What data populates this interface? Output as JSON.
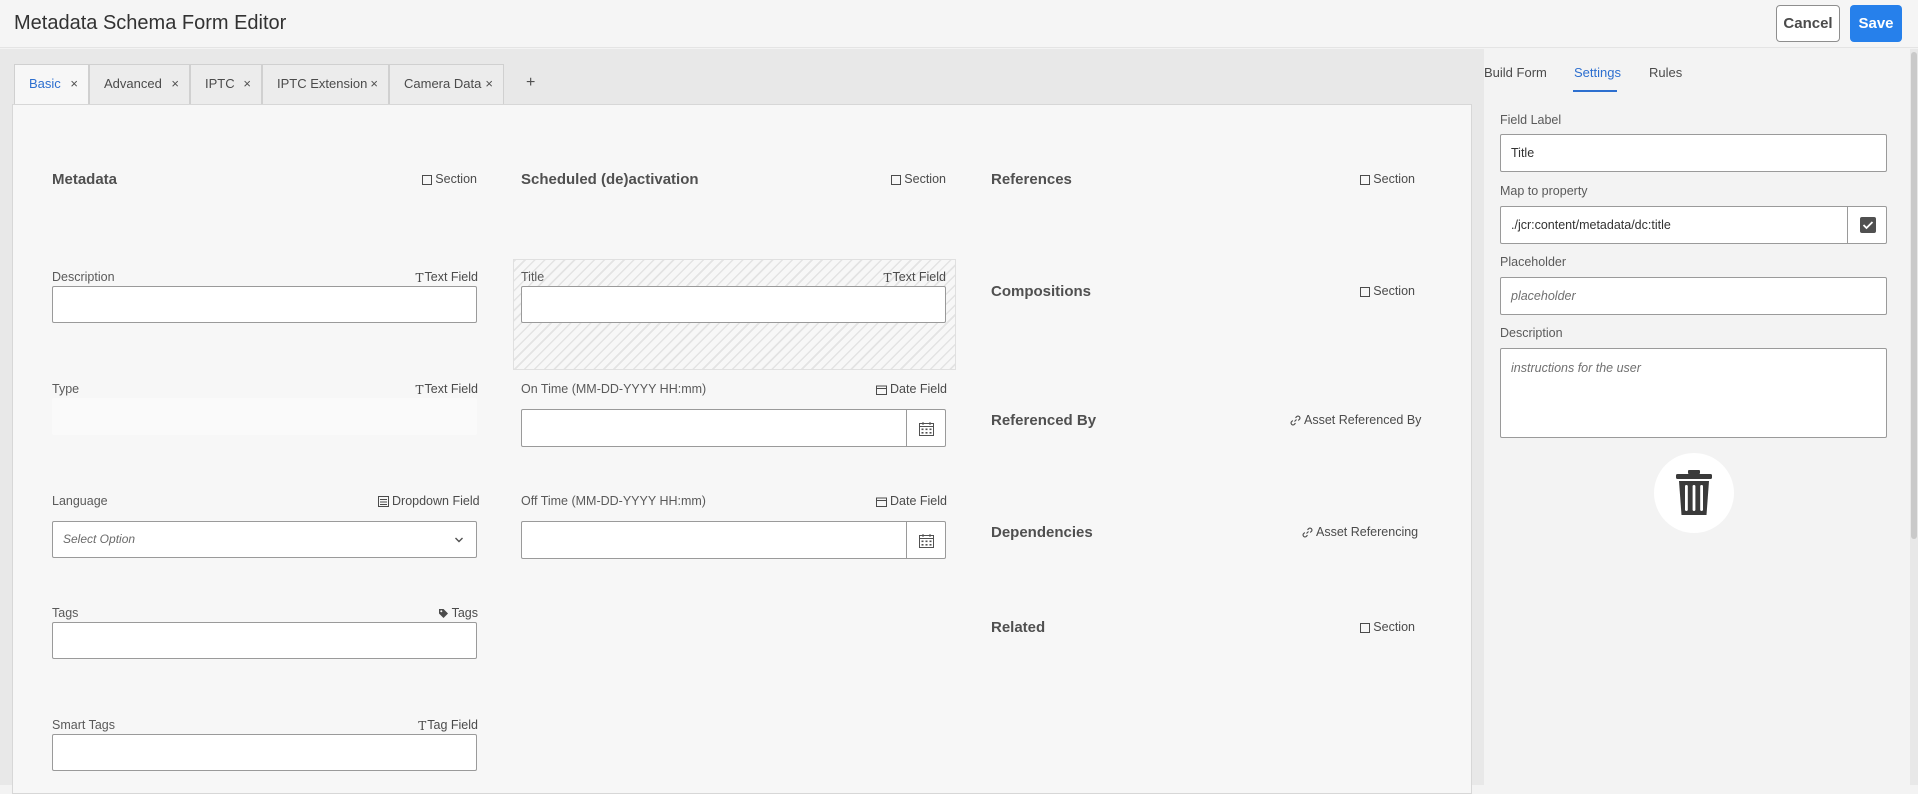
{
  "app": {
    "title": "Metadata Schema Form Editor"
  },
  "header": {
    "cancel_label": "Cancel",
    "save_label": "Save"
  },
  "tabs": [
    {
      "label": "Basic",
      "active": true
    },
    {
      "label": "Advanced"
    },
    {
      "label": "IPTC"
    },
    {
      "label": "IPTC Extension"
    },
    {
      "label": "Camera Data"
    }
  ],
  "tab_close_glyph": "×",
  "tab_add_glyph": "+",
  "columns": {
    "col1": {
      "title": "Metadata",
      "type": "Section",
      "fields": [
        {
          "label": "Description",
          "type": "Text Field"
        },
        {
          "label": "Type",
          "type": "Text Field"
        },
        {
          "label": "Language",
          "type": "Dropdown Field",
          "value": "Select Option"
        },
        {
          "label": "Tags",
          "type": "Tags"
        },
        {
          "label": "Smart Tags",
          "type": "Tag Field"
        }
      ]
    },
    "col2": {
      "title": "Scheduled (de)activation",
      "type": "Section",
      "fields": [
        {
          "label": "Title",
          "type": "Text Field"
        },
        {
          "label": "On Time (MM-DD-YYYY HH:mm)",
          "type": "Date Field"
        },
        {
          "label": "Off Time (MM-DD-YYYY HH:mm)",
          "type": "Date Field"
        }
      ]
    },
    "col3": {
      "items": [
        {
          "title": "References",
          "type": "Section"
        },
        {
          "title": "Compositions",
          "type": "Section"
        },
        {
          "title": "Referenced By",
          "type": "Asset Referenced By"
        },
        {
          "title": "Dependencies",
          "type": "Asset Referencing"
        },
        {
          "title": "Related",
          "type": "Section"
        }
      ]
    }
  },
  "settings": {
    "tabs": [
      "Build Form",
      "Settings",
      "Rules"
    ],
    "active_tab": "Settings",
    "field_label": {
      "label": "Field Label",
      "value": "Title"
    },
    "map_to_property": {
      "label": "Map to property",
      "value": "./jcr:content/metadata/dc:title"
    },
    "placeholder": {
      "label": "Placeholder",
      "placeholder": "placeholder"
    },
    "description": {
      "label": "Description",
      "placeholder": "instructions for the user"
    }
  },
  "icons": [
    "text-field-icon",
    "calendar-icon",
    "dropdown-icon",
    "tag-icon",
    "link-icon",
    "checkbox-icon",
    "trash-icon"
  ],
  "colors": {
    "accent": "#2680eb",
    "active_tab": "#2d6fcf"
  }
}
